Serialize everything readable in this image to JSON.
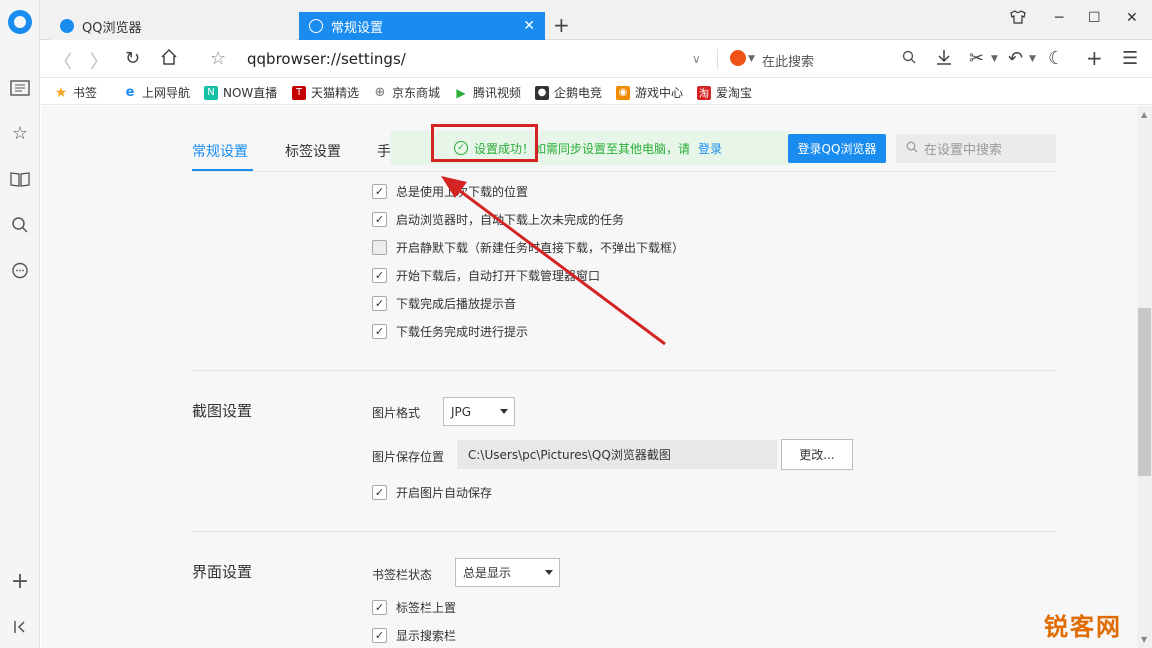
{
  "tabs": [
    {
      "title": "QQ浏览器"
    },
    {
      "title": "常规设置"
    }
  ],
  "address": {
    "url": "qqbrowser://settings/",
    "search_placeholder": "在此搜索"
  },
  "bookmarks": [
    {
      "label": "书签",
      "icon": "star-icon",
      "color": "#f5a623"
    },
    {
      "label": "上网导航",
      "icon": "ie-icon",
      "color": "#1a8cf0"
    },
    {
      "label": "NOW直播",
      "icon": "now-icon",
      "color": "#16c0a6"
    },
    {
      "label": "天猫精选",
      "icon": "tmall-icon",
      "color": "#c40000"
    },
    {
      "label": "京东商城",
      "icon": "globe-icon",
      "color": "#777777"
    },
    {
      "label": "腾讯视频",
      "icon": "play-icon",
      "color": "#2aae38"
    },
    {
      "label": "企鹅电竞",
      "icon": "penguin-icon",
      "color": "#333333"
    },
    {
      "label": "游戏中心",
      "icon": "gamepad-icon",
      "color": "#f08a00"
    },
    {
      "label": "爱淘宝",
      "icon": "taobao-icon",
      "color": "#d42323"
    }
  ],
  "settings": {
    "tabs": [
      "常规设置",
      "标签设置",
      "手"
    ],
    "toast": {
      "message": "设置成功！如需同步设置至其他电脑，请",
      "link": "登录"
    },
    "login_button": "登录QQ浏览器",
    "search_placeholder": "在设置中搜索",
    "download_options": [
      {
        "label": "总是使用上次下载的位置",
        "checked": true
      },
      {
        "label": "启动浏览器时，自动下载上次未完成的任务",
        "checked": true
      },
      {
        "label": "开启静默下载（新建任务时直接下载，不弹出下载框）",
        "checked": false
      },
      {
        "label": "开始下载后，自动打开下载管理器窗口",
        "checked": true
      },
      {
        "label": "下载完成后播放提示音",
        "checked": true
      },
      {
        "label": "下载任务完成时进行提示",
        "checked": true
      }
    ],
    "screenshot": {
      "title": "截图设置",
      "format_label": "图片格式",
      "format_value": "JPG",
      "path_label": "图片保存位置",
      "path_value": "C:\\Users\\pc\\Pictures\\QQ浏览器截图",
      "change_button": "更改...",
      "autosave_label": "开启图片自动保存",
      "autosave_checked": true
    },
    "interface": {
      "title": "界面设置",
      "bookmark_bar_label": "书签栏状态",
      "bookmark_bar_value": "总是显示",
      "options": [
        {
          "label": "标签栏上置",
          "checked": true
        },
        {
          "label": "显示搜索栏",
          "checked": true
        }
      ]
    }
  },
  "watermark": "锐客网",
  "colors": {
    "accent": "#1a8cf0",
    "success": "#2aae38",
    "annotation": "#d42323"
  }
}
